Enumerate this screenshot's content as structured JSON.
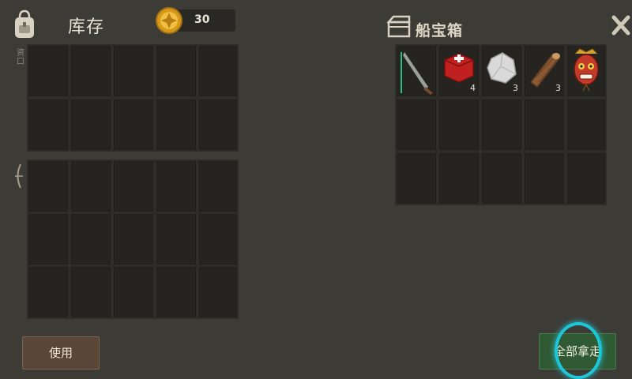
{
  "inventory": {
    "title": "库存",
    "coins": "30",
    "side_tabs": [
      "资",
      "口"
    ],
    "top_grid": {
      "rows": 2,
      "cols": 5
    },
    "bottom_grid": {
      "rows": 3,
      "cols": 5
    }
  },
  "chest": {
    "title": "船宝箱",
    "items": [
      {
        "icon": "machete-icon",
        "count": ""
      },
      {
        "icon": "medkit-icon",
        "count": "4"
      },
      {
        "icon": "stone-icon",
        "count": "3"
      },
      {
        "icon": "wood-log-icon",
        "count": "3"
      },
      {
        "icon": "tribal-mask-icon",
        "count": ""
      }
    ],
    "grid": {
      "rows": 3,
      "cols": 5
    }
  },
  "actions": {
    "use_label": "使用",
    "take_all_label": "全部拿走"
  },
  "colors": {
    "background": "#3d3b36",
    "slot": "#252420",
    "use_button": "#5a4638",
    "take_all_button": "#2f5a34",
    "highlight_ring": "#1ec7d8"
  }
}
